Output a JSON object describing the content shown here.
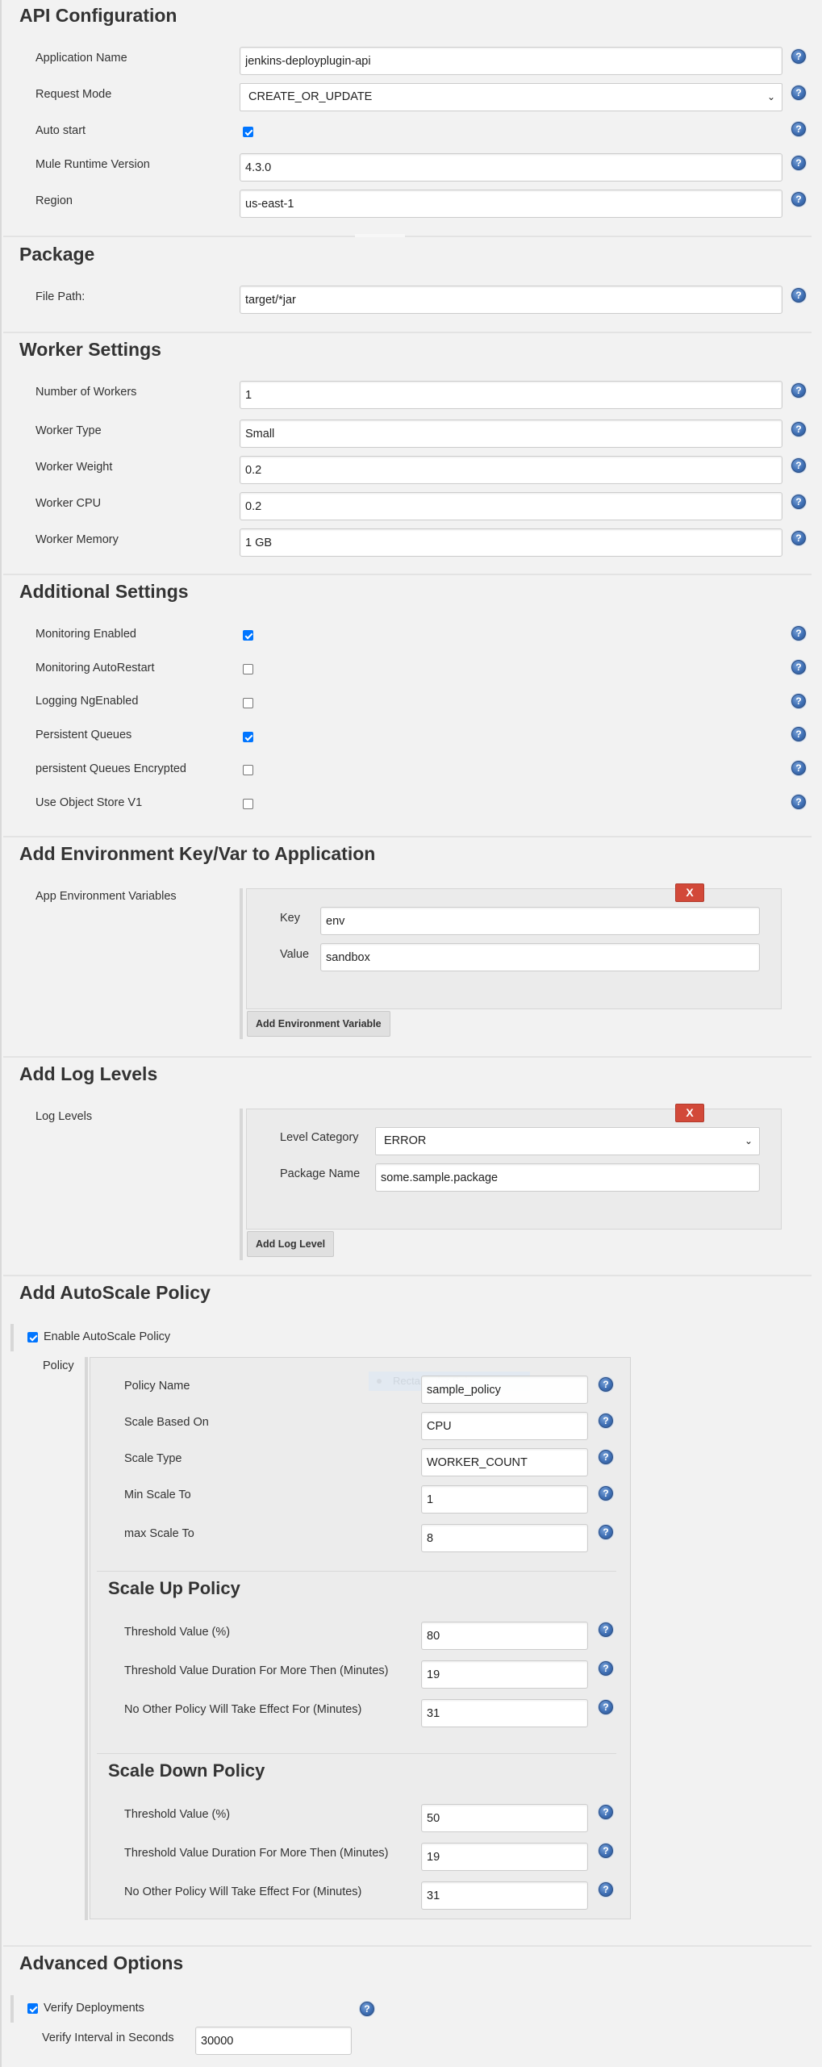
{
  "api_configuration": {
    "title": "API Configuration",
    "application_name": {
      "label": "Application Name",
      "value": "jenkins-deployplugin-api"
    },
    "request_mode": {
      "label": "Request Mode",
      "value": "CREATE_OR_UPDATE"
    },
    "auto_start": {
      "label": "Auto start",
      "checked": true
    },
    "mule_runtime_version": {
      "label": "Mule Runtime Version",
      "value": "4.3.0"
    },
    "region": {
      "label": "Region",
      "value": "us-east-1"
    }
  },
  "package": {
    "title": "Package",
    "file_path": {
      "label": "File Path:",
      "value": "target/*jar"
    }
  },
  "worker_settings": {
    "title": "Worker Settings",
    "fields": [
      {
        "label": "Number of Workers",
        "value": "1"
      },
      {
        "label": "Worker Type",
        "value": "Small"
      },
      {
        "label": "Worker Weight",
        "value": "0.2"
      },
      {
        "label": "Worker CPU",
        "value": "0.2"
      },
      {
        "label": "Worker Memory",
        "value": "1 GB"
      }
    ]
  },
  "additional_settings": {
    "title": "Additional Settings",
    "options": [
      {
        "label": "Monitoring Enabled",
        "checked": true
      },
      {
        "label": "Monitoring AutoRestart",
        "checked": false
      },
      {
        "label": "Logging NgEnabled",
        "checked": false
      },
      {
        "label": "Persistent Queues",
        "checked": true
      },
      {
        "label": "persistent Queues Encrypted",
        "checked": false
      },
      {
        "label": "Use Object Store V1",
        "checked": false
      }
    ]
  },
  "environment": {
    "title": "Add Environment Key/Var to Application",
    "label": "App Environment Variables",
    "delete_label": "X",
    "key": {
      "label": "Key",
      "value": "env"
    },
    "value": {
      "label": "Value",
      "value": "sandbox"
    },
    "add_button": "Add Environment Variable"
  },
  "log_levels": {
    "title": "Add Log Levels",
    "label": "Log Levels",
    "delete_label": "X",
    "level_category": {
      "label": "Level Category",
      "value": "ERROR"
    },
    "package_name": {
      "label": "Package Name",
      "value": "some.sample.package"
    },
    "add_button": "Add Log Level"
  },
  "autoscale": {
    "title": "Add AutoScale Policy",
    "enable": {
      "label": "Enable AutoScale Policy",
      "checked": true
    },
    "policy_label": "Policy",
    "overlay_text": "Rectangular Snip",
    "fields": [
      {
        "label": "Policy Name",
        "value": "sample_policy"
      },
      {
        "label": "Scale Based On",
        "value": "CPU"
      },
      {
        "label": "Scale Type",
        "value": "WORKER_COUNT"
      },
      {
        "label": "Min Scale To",
        "value": "1"
      },
      {
        "label": "max Scale To",
        "value": "8"
      }
    ],
    "scale_up": {
      "title": "Scale Up Policy",
      "fields": [
        {
          "label": "Threshold Value (%)",
          "value": "80"
        },
        {
          "label": "Threshold Value Duration For More Then (Minutes)",
          "value": "19"
        },
        {
          "label": "No Other Policy Will Take Effect For (Minutes)",
          "value": "31"
        }
      ]
    },
    "scale_down": {
      "title": "Scale Down Policy",
      "fields": [
        {
          "label": "Threshold Value (%)",
          "value": "50"
        },
        {
          "label": "Threshold Value Duration For More Then (Minutes)",
          "value": "19"
        },
        {
          "label": "No Other Policy Will Take Effect For (Minutes)",
          "value": "31"
        }
      ]
    }
  },
  "advanced": {
    "title": "Advanced Options",
    "verify_deployments": {
      "label": "Verify Deployments",
      "checked": true
    },
    "verify_interval": {
      "label": "Verify Interval in Seconds",
      "value": "30000"
    }
  },
  "help_icon_glyph": "?"
}
